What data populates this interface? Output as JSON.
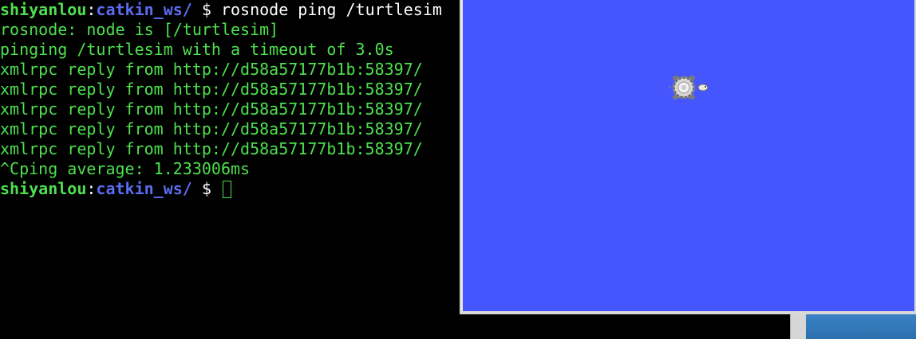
{
  "terminal": {
    "prompt": {
      "user": "shiyanlou",
      "separator": ":",
      "path": "catkin_ws/",
      "dollar": " $ "
    },
    "command": "rosnode ping /turtlesim",
    "output_lines": [
      "rosnode: node is [/turtlesim]",
      "pinging /turtlesim with a timeout of 3.0s",
      "xmlrpc reply from http://d58a57177b1b:58397/",
      "xmlrpc reply from http://d58a57177b1b:58397/",
      "xmlrpc reply from http://d58a57177b1b:58397/",
      "xmlrpc reply from http://d58a57177b1b:58397/",
      "xmlrpc reply from http://d58a57177b1b:58397/",
      "^Cping average: 1.233006ms"
    ],
    "colors": {
      "background": "#000000",
      "output_text": "#4ee04e",
      "prompt_user": "#4ee04e",
      "prompt_path": "#5b6cf0",
      "command_text": "#ffffff"
    }
  },
  "turtlesim": {
    "background_color": "#4556ff",
    "turtle_icon": "turtle-icon"
  },
  "desktop": {
    "panel_color": "#3a82c4"
  }
}
